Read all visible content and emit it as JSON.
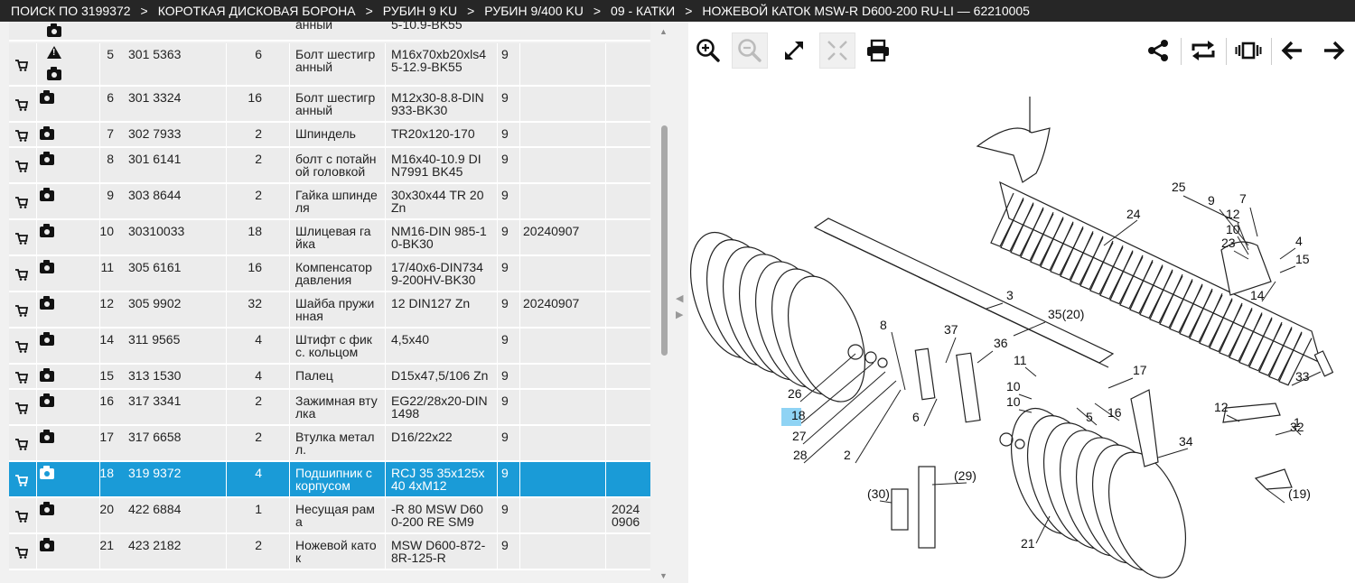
{
  "breadcrumb": [
    "ПОИСК ПО 3199372",
    "КОРОТКАЯ ДИСКОВАЯ БОРОНА",
    "РУБИН 9 KU",
    "РУБИН 9/400 KU",
    "09 - КАТКИ",
    "НОЖЕВОЙ КАТОК MSW-R D600-200 RU-LI — 62210005"
  ],
  "breadcrumb_separator": ">",
  "parts_table": {
    "top_partial_row": {
      "name": "анный",
      "spec": "5-10.9-BK55"
    },
    "rows": [
      {
        "pos": "5",
        "number": "301 5363",
        "qty": "6",
        "name": [
          "Болт шестигр",
          "анный"
        ],
        "spec": [
          "M16x70xb20xls4",
          "5-12.9-BK55"
        ],
        "group": "9",
        "date": "",
        "date2": [
          "",
          ""
        ],
        "warning": true,
        "selected": false
      },
      {
        "pos": "6",
        "number": "301 3324",
        "qty": "16",
        "name": [
          "Болт шестигр",
          "анный"
        ],
        "spec": [
          "M12x30-8.8-DIN",
          "933-BK30"
        ],
        "group": "9",
        "date": "",
        "date2": [
          "",
          ""
        ],
        "warning": false,
        "selected": false
      },
      {
        "pos": "7",
        "number": "302 7933",
        "qty": "2",
        "name": [
          "Шпиндель",
          ""
        ],
        "spec": [
          "TR20x120-170",
          ""
        ],
        "group": "9",
        "date": "",
        "date2": [
          "",
          ""
        ],
        "warning": false,
        "selected": false
      },
      {
        "pos": "8",
        "number": "301 6141",
        "qty": "2",
        "name": [
          "болт с потайн",
          "ой головкой"
        ],
        "spec": [
          "M16x40-10.9 DI",
          "N7991 BK45"
        ],
        "group": "9",
        "date": "",
        "date2": [
          "",
          ""
        ],
        "warning": false,
        "selected": false
      },
      {
        "pos": "9",
        "number": "303 8644",
        "qty": "2",
        "name": [
          "Гайка шпинде",
          "ля"
        ],
        "spec": [
          "30x30x44 TR 20",
          "Zn"
        ],
        "group": "9",
        "date": "",
        "date2": [
          "",
          ""
        ],
        "warning": false,
        "selected": false
      },
      {
        "pos": "10",
        "number": "30310033",
        "qty": "18",
        "name": [
          "Шлицевая га",
          "йка"
        ],
        "spec": [
          "NM16-DIN 985-1",
          "0-BK30"
        ],
        "group": "9",
        "date": "20240907",
        "date2": [
          "",
          ""
        ],
        "warning": false,
        "selected": false
      },
      {
        "pos": "11",
        "number": "305 6161",
        "qty": "16",
        "name": [
          "Компенсатор",
          "давления"
        ],
        "spec": [
          "17/40x6-DIN734",
          "9-200HV-BK30"
        ],
        "group": "9",
        "date": "",
        "date2": [
          "",
          ""
        ],
        "warning": false,
        "selected": false
      },
      {
        "pos": "12",
        "number": "305 9902",
        "qty": "32",
        "name": [
          "Шайба пружи",
          "нная"
        ],
        "spec": [
          "12 DIN127 Zn",
          ""
        ],
        "group": "9",
        "date": "20240907",
        "date2": [
          "",
          ""
        ],
        "warning": false,
        "selected": false
      },
      {
        "pos": "14",
        "number": "311 9565",
        "qty": "4",
        "name": [
          "Штифт с фик",
          "с. кольцом"
        ],
        "spec": [
          "4,5x40",
          ""
        ],
        "group": "9",
        "date": "",
        "date2": [
          "",
          ""
        ],
        "warning": false,
        "selected": false
      },
      {
        "pos": "15",
        "number": "313 1530",
        "qty": "4",
        "name": [
          "Палец",
          ""
        ],
        "spec": [
          "D15x47,5/106 Zn",
          ""
        ],
        "group": "9",
        "date": "",
        "date2": [
          "",
          ""
        ],
        "warning": false,
        "selected": false
      },
      {
        "pos": "16",
        "number": "317 3341",
        "qty": "2",
        "name": [
          "Зажимная вту",
          "лка"
        ],
        "spec": [
          "EG22/28x20-DIN",
          "1498"
        ],
        "group": "9",
        "date": "",
        "date2": [
          "",
          ""
        ],
        "warning": false,
        "selected": false
      },
      {
        "pos": "17",
        "number": "317 6658",
        "qty": "2",
        "name": [
          "Втулка метал",
          "л."
        ],
        "spec": [
          "D16/22x22",
          ""
        ],
        "group": "9",
        "date": "",
        "date2": [
          "",
          ""
        ],
        "warning": false,
        "selected": false
      },
      {
        "pos": "18",
        "number": "319 9372",
        "qty": "4",
        "name": [
          "Подшипник с",
          "корпусом"
        ],
        "spec": [
          "RCJ 35 35x125x",
          "40 4xM12"
        ],
        "group": "9",
        "date": "",
        "date2": [
          "",
          ""
        ],
        "warning": false,
        "selected": true
      },
      {
        "pos": "20",
        "number": "422 6884",
        "qty": "1",
        "name": [
          "Несущая рам",
          "а"
        ],
        "spec": [
          "-R 80 MSW D60",
          "0-200 RE SM9"
        ],
        "group": "9",
        "date": "",
        "date2": [
          "2024",
          "0906"
        ],
        "warning": false,
        "selected": false
      },
      {
        "pos": "21",
        "number": "423 2182",
        "qty": "2",
        "name": [
          "Ножевой като",
          "к"
        ],
        "spec": [
          "MSW D600-872-",
          "8R-125-R"
        ],
        "group": "9",
        "date": "",
        "date2": [
          "",
          ""
        ],
        "warning": false,
        "selected": false
      }
    ]
  },
  "toolbar": {
    "left": [
      "zoom-in-icon",
      "zoom-out-icon",
      "expand-icon",
      "fit-icon",
      "print-icon"
    ],
    "right": [
      "share-icon",
      "rotate-icon",
      "carousel-icon",
      "arrow-left-icon",
      "arrow-right-icon"
    ]
  },
  "diagram": {
    "labels": [
      "25",
      "9",
      "7",
      "12",
      "10",
      "23",
      "4",
      "15",
      "14",
      "24",
      "3",
      "35(20)",
      "8",
      "37",
      "36",
      "11",
      "10",
      "17",
      "33",
      "26",
      "18",
      "27",
      "28",
      "2",
      "6",
      "10",
      "5",
      "16",
      "12",
      "32",
      "1",
      "34",
      "(29)",
      "(30)",
      "(19)",
      "21"
    ],
    "highlighted": "18",
    "highlight_color": "#8fd3f4"
  },
  "colors": {
    "selected_row": "#1a9bd7",
    "header_bg": "#262626"
  }
}
